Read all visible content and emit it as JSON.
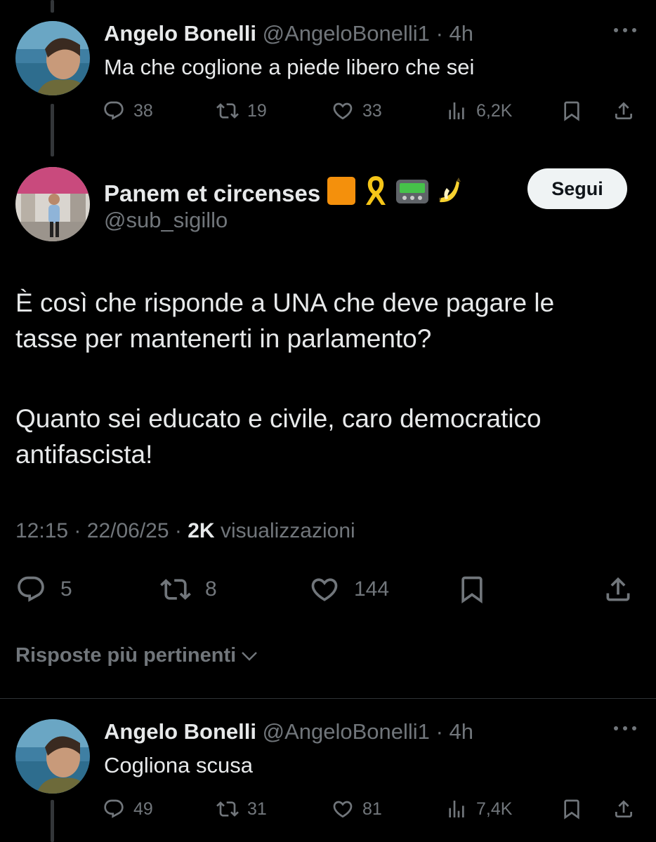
{
  "top_reply": {
    "name": "Angelo Bonelli",
    "handle": "@AngeloBonelli1",
    "separator": "·",
    "time": "4h",
    "text": "Ma che coglione a piede libero che sei",
    "replies": "38",
    "reposts": "19",
    "likes": "33",
    "views": "6,2K"
  },
  "main_tweet": {
    "name": "Panem et circenses",
    "name_emojis": [
      "orange-square",
      "yellow-ribbon",
      "pager",
      "banana"
    ],
    "handle": "@sub_sigillo",
    "follow_label": "Segui",
    "paragraph1_line1": "È così che risponde a UNA che deve pagare le",
    "paragraph1_line2": "tasse per mantenerti in parlamento?",
    "paragraph2_line1": "Quanto sei educato e civile, caro democratico",
    "paragraph2_line2": "antifascista!",
    "time": "12:15",
    "date": "22/06/25",
    "separator": "·",
    "views_count": "2K",
    "views_label": "visualizzazioni",
    "replies": "5",
    "reposts": "8",
    "likes": "144"
  },
  "sort": {
    "label": "Risposte più pertinenti"
  },
  "bottom_reply": {
    "name": "Angelo Bonelli",
    "handle": "@AngeloBonelli1",
    "separator": "·",
    "time": "4h",
    "text": "Cogliona scusa",
    "replies": "49",
    "reposts": "31",
    "likes": "81",
    "views": "7,4K"
  },
  "colors": {
    "background": "#000000",
    "text": "#e7e9ea",
    "muted": "#71767b",
    "follow_bg": "#eff3f4",
    "divider": "#2f3336"
  }
}
